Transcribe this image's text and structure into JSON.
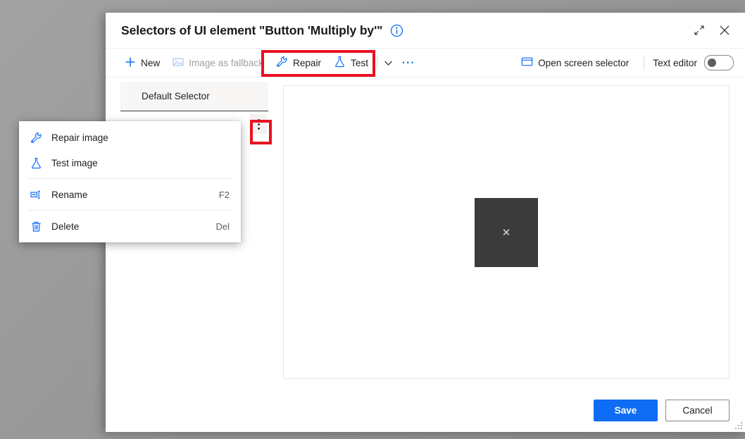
{
  "dialog": {
    "title": "Selectors of UI element \"Button 'Multiply by'\"",
    "info_icon": "info-circle-icon",
    "expand_icon": "expand-diagonal-icon",
    "close_icon": "close-icon"
  },
  "toolbar": {
    "new_label": "New",
    "new_icon": "plus-icon",
    "image_fallback_label": "Image as fallback",
    "image_fallback_icon": "image-icon",
    "repair_label": "Repair",
    "repair_icon": "wrench-icon",
    "test_label": "Test",
    "test_icon": "flask-icon",
    "caret_icon": "chevron-down-icon",
    "overflow_icon": "ellipsis-horizontal-icon",
    "open_screen_selector_label": "Open screen selector",
    "open_screen_selector_icon": "window-icon",
    "text_editor_label": "Text editor",
    "text_editor_state": "off",
    "highlight_color": "#e81123"
  },
  "list": {
    "header_label": "Default Selector",
    "kebab_icon": "more-vertical-icon"
  },
  "preview": {
    "broken_image_glyph": "✕"
  },
  "context_menu": {
    "items": [
      {
        "label": "Repair image",
        "icon": "wrench-icon",
        "shortcut": ""
      },
      {
        "label": "Test image",
        "icon": "flask-icon",
        "shortcut": ""
      },
      {
        "label": "Rename",
        "icon": "rename-icon",
        "shortcut": "F2"
      },
      {
        "label": "Delete",
        "icon": "trash-icon",
        "shortcut": "Del"
      }
    ]
  },
  "footer": {
    "save_label": "Save",
    "cancel_label": "Cancel",
    "primary_color": "#0f6cf5"
  }
}
